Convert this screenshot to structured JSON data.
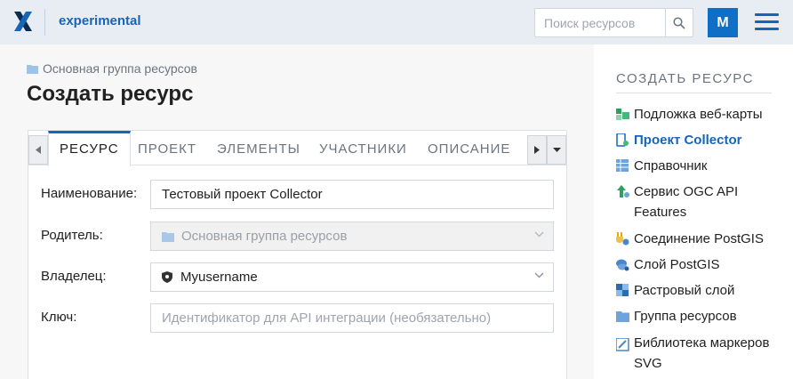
{
  "header": {
    "app_name": "experimental",
    "search_placeholder": "Поиск ресурсов",
    "avatar_letter": "M"
  },
  "breadcrumb": {
    "parent": "Основная группа ресурсов"
  },
  "page_title": "Создать ресурс",
  "tabs": [
    {
      "label": "РЕСУРС",
      "active": true
    },
    {
      "label": "ПРОЕКТ"
    },
    {
      "label": "ЭЛЕМЕНТЫ"
    },
    {
      "label": "УЧАСТНИКИ"
    },
    {
      "label": "ОПИСАНИЕ"
    }
  ],
  "form": {
    "name_label": "Наименование:",
    "name_value": "Тестовый проект Collector",
    "parent_label": "Родитель:",
    "parent_value": "Основная группа ресурсов",
    "owner_label": "Владелец:",
    "owner_value": "Myusername",
    "key_label": "Ключ:",
    "key_placeholder": "Идентификатор для API интеграции (необязательно)"
  },
  "sidebar": {
    "title": "СОЗДАТЬ РЕСУРС",
    "items": [
      {
        "label": "Подложка веб-карты",
        "icon": "basemap-icon"
      },
      {
        "label": "Проект Collector",
        "icon": "collector-icon",
        "active": true
      },
      {
        "label": "Справочник",
        "icon": "lookup-table-icon"
      },
      {
        "label": "Сервис OGC API Features",
        "icon": "ogc-service-icon"
      },
      {
        "label": "Соединение PostGIS",
        "icon": "postgis-connection-icon"
      },
      {
        "label": "Слой PostGIS",
        "icon": "postgis-layer-icon"
      },
      {
        "label": "Растровый слой",
        "icon": "raster-layer-icon"
      },
      {
        "label": "Группа ресурсов",
        "icon": "folder-icon"
      },
      {
        "label": "Библиотека маркеров SVG",
        "icon": "svg-library-icon"
      }
    ]
  },
  "colors": {
    "accent": "#1565b8",
    "header_bg": "#e8edf4"
  }
}
